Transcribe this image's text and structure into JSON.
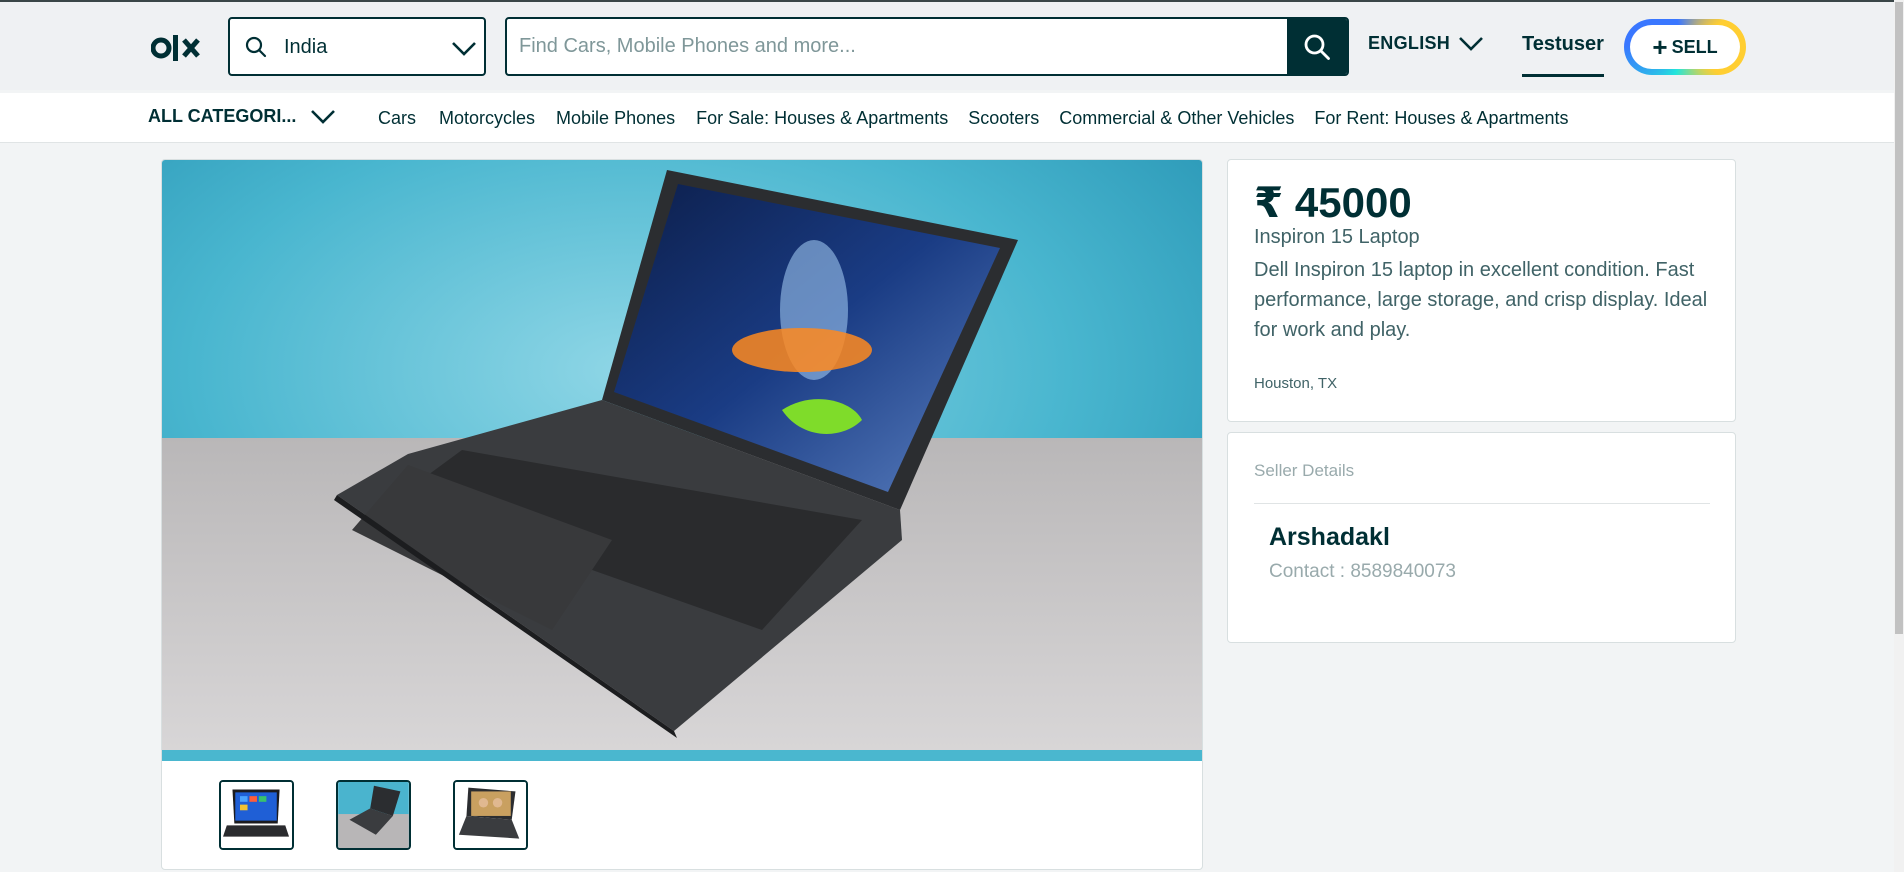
{
  "header": {
    "logo_text": "olx",
    "location": {
      "value": "India"
    },
    "search": {
      "placeholder": "Find Cars, Mobile Phones and more..."
    },
    "language_label": "ENGLISH",
    "username": "Testuser",
    "sell_plus": "+",
    "sell_label": "SELL"
  },
  "categories": {
    "all_label": "ALL CATEGORI...",
    "items": [
      "Cars",
      "Motorcycles",
      "Mobile Phones",
      "For Sale: Houses & Apartments",
      "Scooters",
      "Commercial & Other Vehicles",
      "For Rent: Houses & Apartments"
    ]
  },
  "listing": {
    "price": "₹ 45000",
    "title": "Inspiron 15 Laptop",
    "description": "Dell Inspiron 15 laptop in excellent condition. Fast performance, large storage, and crisp display. Ideal for work and play.",
    "location": "Houston, TX",
    "image_icon": "laptop-photo",
    "thumbnails": [
      "laptop-thumbnail-front",
      "laptop-thumbnail-side",
      "laptop-thumbnail-open"
    ]
  },
  "seller": {
    "heading": "Seller Details",
    "name": "Arshadakl",
    "contact": "Contact : 8589840073"
  },
  "colors": {
    "brand": "#002f34",
    "page_bg": "#f2f4f5",
    "image_bg": "#3eb3cd",
    "muted_text": "#99aaac"
  }
}
